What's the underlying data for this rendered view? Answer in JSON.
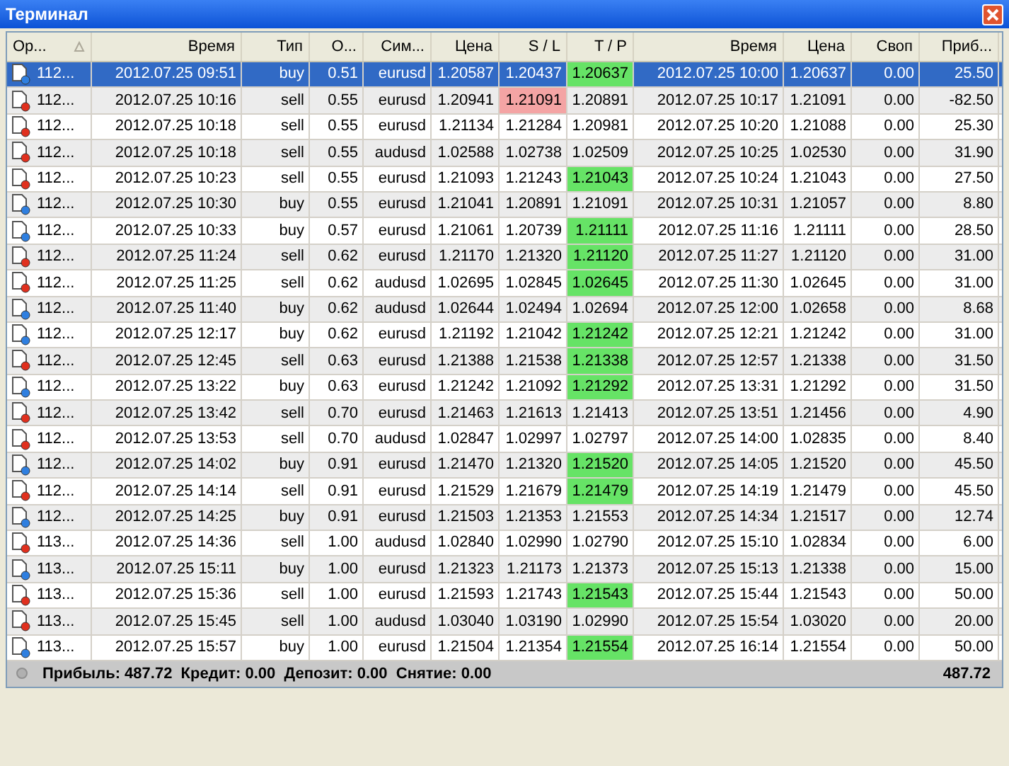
{
  "window": {
    "title": "Терминал"
  },
  "table": {
    "columns": [
      {
        "label": "Ор...",
        "sorted": true
      },
      {
        "label": "Время",
        "sorted": false
      },
      {
        "label": "Тип",
        "sorted": false
      },
      {
        "label": "О...",
        "sorted": false
      },
      {
        "label": "Сим...",
        "sorted": false
      },
      {
        "label": "Цена",
        "sorted": false
      },
      {
        "label": "S / L",
        "sorted": false
      },
      {
        "label": "T / P",
        "sorted": false
      },
      {
        "label": "Время",
        "sorted": false
      },
      {
        "label": "Цена",
        "sorted": false
      },
      {
        "label": "Своп",
        "sorted": false
      },
      {
        "label": "Приб...",
        "sorted": false
      }
    ],
    "rows": [
      {
        "kind": "buy",
        "selected": true,
        "sl_hit": false,
        "tp_hit": true,
        "cells": [
          "112...",
          "2012.07.25 09:51",
          "buy",
          "0.51",
          "eurusd",
          "1.20587",
          "1.20437",
          "1.20637",
          "2012.07.25 10:00",
          "1.20637",
          "0.00",
          "25.50"
        ]
      },
      {
        "kind": "sell",
        "selected": false,
        "sl_hit": true,
        "tp_hit": false,
        "cells": [
          "112...",
          "2012.07.25 10:16",
          "sell",
          "0.55",
          "eurusd",
          "1.20941",
          "1.21091",
          "1.20891",
          "2012.07.25 10:17",
          "1.21091",
          "0.00",
          "-82.50"
        ]
      },
      {
        "kind": "sell",
        "selected": false,
        "sl_hit": false,
        "tp_hit": false,
        "cells": [
          "112...",
          "2012.07.25 10:18",
          "sell",
          "0.55",
          "eurusd",
          "1.21134",
          "1.21284",
          "1.20981",
          "2012.07.25 10:20",
          "1.21088",
          "0.00",
          "25.30"
        ]
      },
      {
        "kind": "sell",
        "selected": false,
        "sl_hit": false,
        "tp_hit": false,
        "cells": [
          "112...",
          "2012.07.25 10:18",
          "sell",
          "0.55",
          "audusd",
          "1.02588",
          "1.02738",
          "1.02509",
          "2012.07.25 10:25",
          "1.02530",
          "0.00",
          "31.90"
        ]
      },
      {
        "kind": "sell",
        "selected": false,
        "sl_hit": false,
        "tp_hit": true,
        "cells": [
          "112...",
          "2012.07.25 10:23",
          "sell",
          "0.55",
          "eurusd",
          "1.21093",
          "1.21243",
          "1.21043",
          "2012.07.25 10:24",
          "1.21043",
          "0.00",
          "27.50"
        ]
      },
      {
        "kind": "buy",
        "selected": false,
        "sl_hit": false,
        "tp_hit": false,
        "cells": [
          "112...",
          "2012.07.25 10:30",
          "buy",
          "0.55",
          "eurusd",
          "1.21041",
          "1.20891",
          "1.21091",
          "2012.07.25 10:31",
          "1.21057",
          "0.00",
          "8.80"
        ]
      },
      {
        "kind": "buy",
        "selected": false,
        "sl_hit": false,
        "tp_hit": true,
        "cells": [
          "112...",
          "2012.07.25 10:33",
          "buy",
          "0.57",
          "eurusd",
          "1.21061",
          "1.20739",
          "1.21111",
          "2012.07.25 11:16",
          "1.21111",
          "0.00",
          "28.50"
        ]
      },
      {
        "kind": "sell",
        "selected": false,
        "sl_hit": false,
        "tp_hit": true,
        "cells": [
          "112...",
          "2012.07.25 11:24",
          "sell",
          "0.62",
          "eurusd",
          "1.21170",
          "1.21320",
          "1.21120",
          "2012.07.25 11:27",
          "1.21120",
          "0.00",
          "31.00"
        ]
      },
      {
        "kind": "sell",
        "selected": false,
        "sl_hit": false,
        "tp_hit": true,
        "cells": [
          "112...",
          "2012.07.25 11:25",
          "sell",
          "0.62",
          "audusd",
          "1.02695",
          "1.02845",
          "1.02645",
          "2012.07.25 11:30",
          "1.02645",
          "0.00",
          "31.00"
        ]
      },
      {
        "kind": "buy",
        "selected": false,
        "sl_hit": false,
        "tp_hit": false,
        "cells": [
          "112...",
          "2012.07.25 11:40",
          "buy",
          "0.62",
          "audusd",
          "1.02644",
          "1.02494",
          "1.02694",
          "2012.07.25 12:00",
          "1.02658",
          "0.00",
          "8.68"
        ]
      },
      {
        "kind": "buy",
        "selected": false,
        "sl_hit": false,
        "tp_hit": true,
        "cells": [
          "112...",
          "2012.07.25 12:17",
          "buy",
          "0.62",
          "eurusd",
          "1.21192",
          "1.21042",
          "1.21242",
          "2012.07.25 12:21",
          "1.21242",
          "0.00",
          "31.00"
        ]
      },
      {
        "kind": "sell",
        "selected": false,
        "sl_hit": false,
        "tp_hit": true,
        "cells": [
          "112...",
          "2012.07.25 12:45",
          "sell",
          "0.63",
          "eurusd",
          "1.21388",
          "1.21538",
          "1.21338",
          "2012.07.25 12:57",
          "1.21338",
          "0.00",
          "31.50"
        ]
      },
      {
        "kind": "buy",
        "selected": false,
        "sl_hit": false,
        "tp_hit": true,
        "cells": [
          "112...",
          "2012.07.25 13:22",
          "buy",
          "0.63",
          "eurusd",
          "1.21242",
          "1.21092",
          "1.21292",
          "2012.07.25 13:31",
          "1.21292",
          "0.00",
          "31.50"
        ]
      },
      {
        "kind": "sell",
        "selected": false,
        "sl_hit": false,
        "tp_hit": false,
        "cells": [
          "112...",
          "2012.07.25 13:42",
          "sell",
          "0.70",
          "eurusd",
          "1.21463",
          "1.21613",
          "1.21413",
          "2012.07.25 13:51",
          "1.21456",
          "0.00",
          "4.90"
        ]
      },
      {
        "kind": "sell",
        "selected": false,
        "sl_hit": false,
        "tp_hit": false,
        "cells": [
          "112...",
          "2012.07.25 13:53",
          "sell",
          "0.70",
          "audusd",
          "1.02847",
          "1.02997",
          "1.02797",
          "2012.07.25 14:00",
          "1.02835",
          "0.00",
          "8.40"
        ]
      },
      {
        "kind": "buy",
        "selected": false,
        "sl_hit": false,
        "tp_hit": true,
        "cells": [
          "112...",
          "2012.07.25 14:02",
          "buy",
          "0.91",
          "eurusd",
          "1.21470",
          "1.21320",
          "1.21520",
          "2012.07.25 14:05",
          "1.21520",
          "0.00",
          "45.50"
        ]
      },
      {
        "kind": "sell",
        "selected": false,
        "sl_hit": false,
        "tp_hit": true,
        "cells": [
          "112...",
          "2012.07.25 14:14",
          "sell",
          "0.91",
          "eurusd",
          "1.21529",
          "1.21679",
          "1.21479",
          "2012.07.25 14:19",
          "1.21479",
          "0.00",
          "45.50"
        ]
      },
      {
        "kind": "buy",
        "selected": false,
        "sl_hit": false,
        "tp_hit": false,
        "cells": [
          "112...",
          "2012.07.25 14:25",
          "buy",
          "0.91",
          "eurusd",
          "1.21503",
          "1.21353",
          "1.21553",
          "2012.07.25 14:34",
          "1.21517",
          "0.00",
          "12.74"
        ]
      },
      {
        "kind": "sell",
        "selected": false,
        "sl_hit": false,
        "tp_hit": false,
        "cells": [
          "113...",
          "2012.07.25 14:36",
          "sell",
          "1.00",
          "audusd",
          "1.02840",
          "1.02990",
          "1.02790",
          "2012.07.25 15:10",
          "1.02834",
          "0.00",
          "6.00"
        ]
      },
      {
        "kind": "buy",
        "selected": false,
        "sl_hit": false,
        "tp_hit": false,
        "cells": [
          "113...",
          "2012.07.25 15:11",
          "buy",
          "1.00",
          "eurusd",
          "1.21323",
          "1.21173",
          "1.21373",
          "2012.07.25 15:13",
          "1.21338",
          "0.00",
          "15.00"
        ]
      },
      {
        "kind": "sell",
        "selected": false,
        "sl_hit": false,
        "tp_hit": true,
        "cells": [
          "113...",
          "2012.07.25 15:36",
          "sell",
          "1.00",
          "eurusd",
          "1.21593",
          "1.21743",
          "1.21543",
          "2012.07.25 15:44",
          "1.21543",
          "0.00",
          "50.00"
        ]
      },
      {
        "kind": "sell",
        "selected": false,
        "sl_hit": false,
        "tp_hit": false,
        "cells": [
          "113...",
          "2012.07.25 15:45",
          "sell",
          "1.00",
          "audusd",
          "1.03040",
          "1.03190",
          "1.02990",
          "2012.07.25 15:54",
          "1.03020",
          "0.00",
          "20.00"
        ]
      },
      {
        "kind": "buy",
        "selected": false,
        "sl_hit": false,
        "tp_hit": true,
        "cells": [
          "113...",
          "2012.07.25 15:57",
          "buy",
          "1.00",
          "eurusd",
          "1.21504",
          "1.21354",
          "1.21554",
          "2012.07.25 16:14",
          "1.21554",
          "0.00",
          "50.00"
        ]
      }
    ]
  },
  "summary": {
    "text": "Прибыль: 487.72  Кредит: 0.00  Депозит: 0.00  Снятие: 0.00",
    "total": "487.72"
  }
}
